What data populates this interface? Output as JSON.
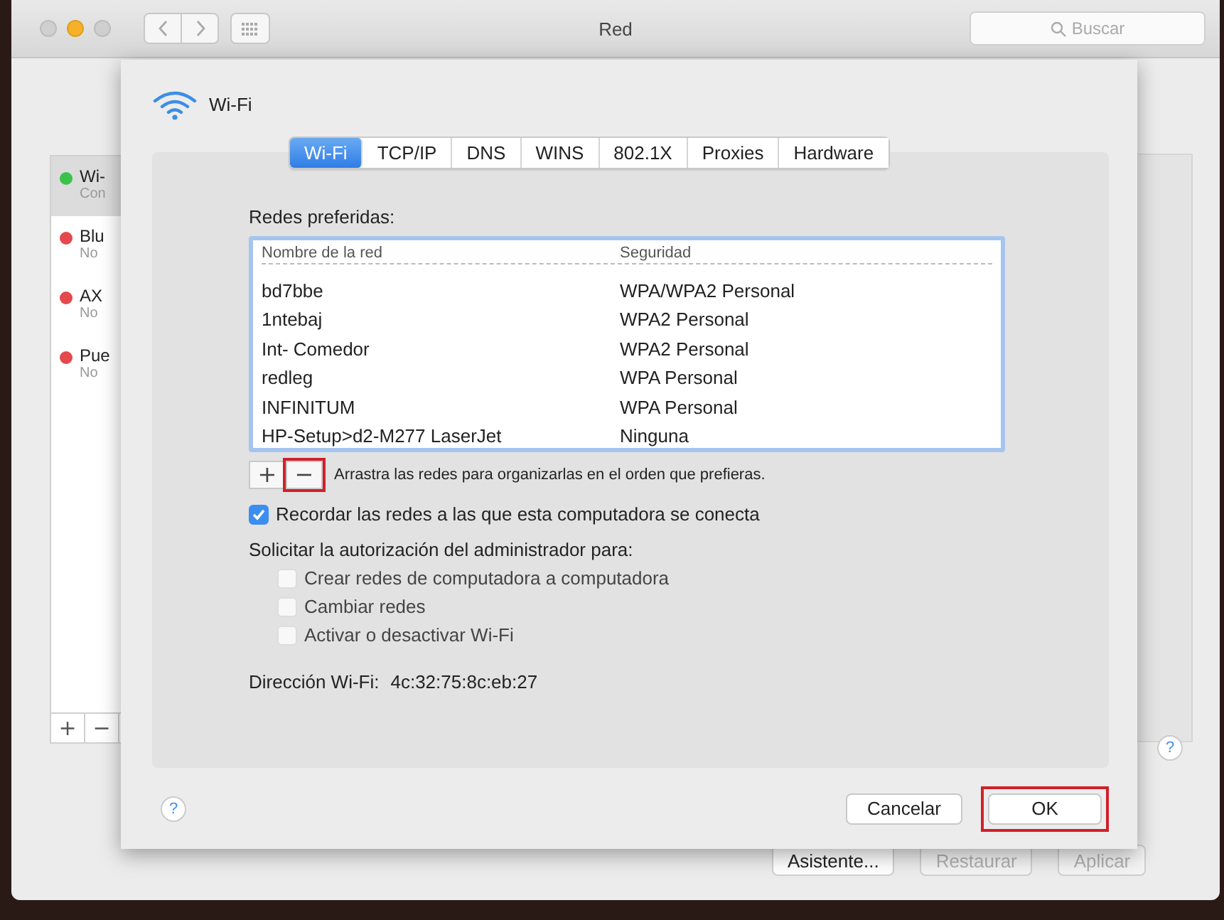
{
  "window": {
    "title": "Red",
    "search": {
      "placeholder": "Buscar"
    }
  },
  "sidebar": {
    "items": [
      {
        "name": "Wi-",
        "status": "Con",
        "color": "#3cc24a",
        "selected": true
      },
      {
        "name": "Blu",
        "status": "No",
        "color": "#e5484d",
        "selected": false
      },
      {
        "name": "AX",
        "status": "No",
        "color": "#e5484d",
        "selected": false
      },
      {
        "name": "Pue",
        "status": "No",
        "color": "#e5484d",
        "selected": false
      }
    ],
    "add": "+",
    "remove": "−"
  },
  "footer_buttons": [
    {
      "label": "Asistente...",
      "disabled": false
    },
    {
      "label": "Restaurar",
      "disabled": true
    },
    {
      "label": "Aplicar",
      "disabled": true
    }
  ],
  "sheet": {
    "title": "Wi-Fi",
    "tabs": [
      {
        "label": "Wi-Fi",
        "selected": true
      },
      {
        "label": "TCP/IP",
        "selected": false
      },
      {
        "label": "DNS",
        "selected": false
      },
      {
        "label": "WINS",
        "selected": false
      },
      {
        "label": "802.1X",
        "selected": false
      },
      {
        "label": "Proxies",
        "selected": false
      },
      {
        "label": "Hardware",
        "selected": false
      }
    ],
    "networks_label": "Redes preferidas:",
    "table": {
      "columns": [
        "Nombre de la red",
        "Seguridad"
      ],
      "rows": [
        [
          "bd7bbe",
          "WPA/WPA2 Personal"
        ],
        [
          "1ntebaj",
          "WPA2 Personal"
        ],
        [
          "Int- Comedor",
          "WPA2 Personal"
        ],
        [
          "redleg",
          "WPA Personal"
        ],
        [
          "INFINITUM",
          "WPA Personal"
        ],
        [
          "HP-Setup>d2-M277 LaserJet",
          "Ninguna"
        ]
      ]
    },
    "add": {
      "label": "+",
      "highlighted": false
    },
    "remove": {
      "label": "−",
      "highlighted": true
    },
    "hint": "Arrastra las redes para organizarlas en el orden que prefieras.",
    "remember": {
      "label": "Recordar las redes a las que esta computadora se conecta",
      "checked": true
    },
    "admin_label": "Solicitar la autorización del administrador para:",
    "admin_options": [
      {
        "label": "Crear redes de computadora a computadora",
        "checked": false
      },
      {
        "label": "Cambiar redes",
        "checked": false
      },
      {
        "label": "Activar o desactivar Wi-Fi",
        "checked": false
      }
    ],
    "address_label": "Dirección Wi-Fi:",
    "address": "4c:32:75:8c:eb:27",
    "help": "?",
    "buttons": [
      {
        "label": "Cancelar",
        "highlighted": false
      },
      {
        "label": "OK",
        "highlighted": true
      }
    ]
  },
  "help": "?"
}
